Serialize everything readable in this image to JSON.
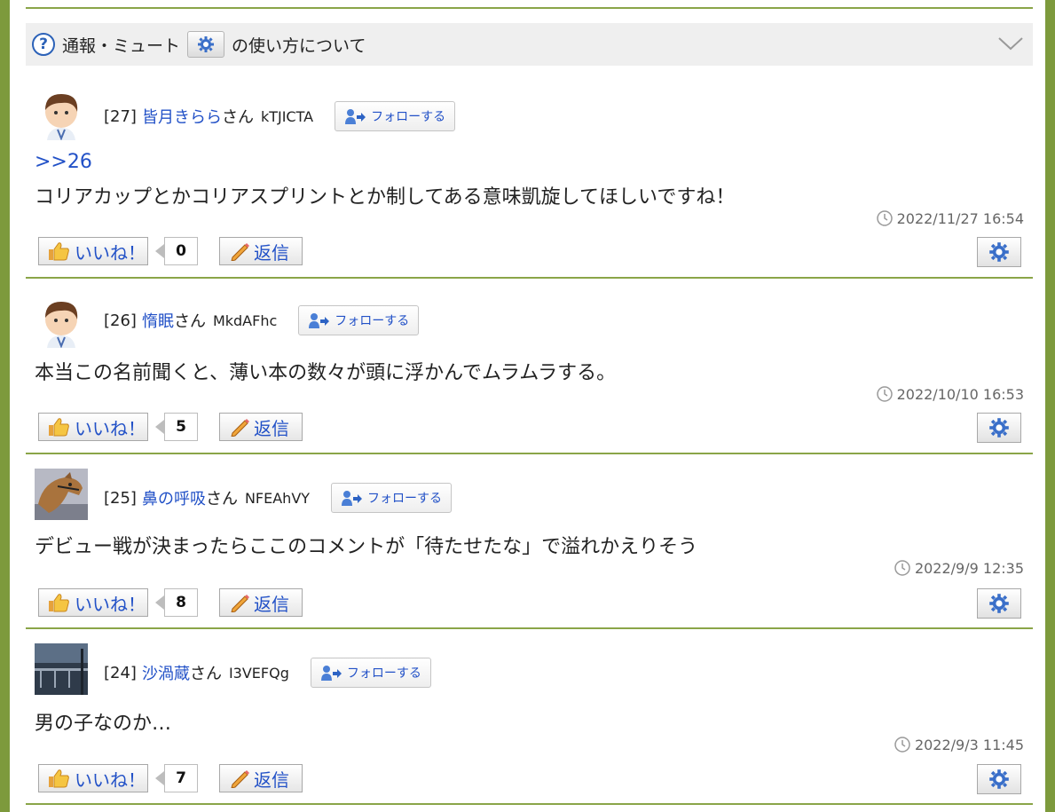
{
  "info_bar": {
    "prefix": "通報・ミュート",
    "suffix": "の使い方について"
  },
  "comments": [
    {
      "number": "[27]",
      "username": "皆月きらら",
      "honorific": "さん",
      "user_id": "kTJICTA",
      "follow_label": "フォローする",
      "reply_anchor": ">>26",
      "text": "コリアカップとかコリアスプリントとか制してある意味凱旋してほしいですね！",
      "timestamp": "2022/11/27 16:54",
      "like_label": "いいね！",
      "like_count": "0",
      "reply_label": "返信"
    },
    {
      "number": "[26]",
      "username": "惰眠",
      "honorific": "さん",
      "user_id": "MkdAFhc",
      "follow_label": "フォローする",
      "text": "本当この名前聞くと、薄い本の数々が頭に浮かんでムラムラする。",
      "timestamp": "2022/10/10 16:53",
      "like_label": "いいね！",
      "like_count": "5",
      "reply_label": "返信"
    },
    {
      "number": "[25]",
      "username": "鼻の呼吸",
      "honorific": "さん",
      "user_id": "NFEAhVY",
      "follow_label": "フォローする",
      "text": "デビュー戦が決まったらここのコメントが「待たせたな」で溢れかえりそう",
      "timestamp": "2022/9/9 12:35",
      "like_label": "いいね！",
      "like_count": "8",
      "reply_label": "返信"
    },
    {
      "number": "[24]",
      "username": "沙渦蔵",
      "honorific": "さん",
      "user_id": "I3VEFQg",
      "follow_label": "フォローする",
      "text": "男の子なのか…",
      "timestamp": "2022/9/3 11:45",
      "like_label": "いいね！",
      "like_count": "7",
      "reply_label": "返信"
    }
  ],
  "colors": {
    "frame": "#7d9a3c",
    "link": "#2251c7",
    "divider": "#8aa548"
  }
}
